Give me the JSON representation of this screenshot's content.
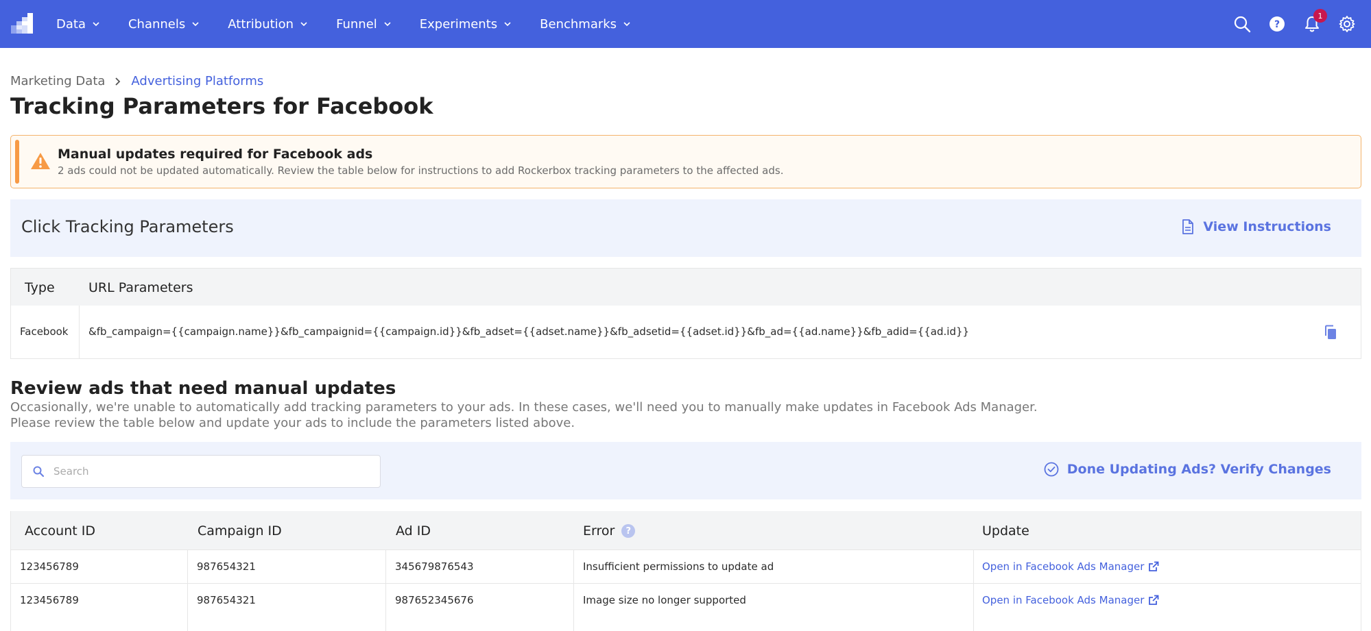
{
  "nav": {
    "items": [
      {
        "label": "Data"
      },
      {
        "label": "Channels"
      },
      {
        "label": "Attribution"
      },
      {
        "label": "Funnel"
      },
      {
        "label": "Experiments"
      },
      {
        "label": "Benchmarks"
      }
    ],
    "notification_count": "1"
  },
  "breadcrumb": {
    "root": "Marketing Data",
    "current": "Advertising Platforms"
  },
  "page_title": "Tracking Parameters for Facebook",
  "warning": {
    "title": "Manual updates required for Facebook ads",
    "text": "2 ads could not be updated automatically. Review the table below for instructions to add Rockerbox tracking parameters to the affected ads.",
    "color": "#f79a45"
  },
  "click_tracking": {
    "title": "Click Tracking Parameters",
    "view_instructions": "View Instructions"
  },
  "param_table": {
    "headers": [
      "Type",
      "URL Parameters"
    ],
    "rows": [
      {
        "type": "Facebook",
        "url": "&fb_campaign={{campaign.name}}&fb_campaignid={{campaign.id}}&fb_adset={{adset.name}}&fb_adsetid={{adset.id}}&fb_ad={{ad.name}}&fb_adid={{ad.id}}"
      }
    ]
  },
  "review": {
    "title": "Review ads that need manual updates",
    "desc_line1": "Occasionally, we're unable to automatically add tracking parameters to your ads. In these cases, we'll need you to manually make updates in Facebook Ads Manager.",
    "desc_line2": "Please review the table below and update your ads to include the parameters listed above.",
    "search_placeholder": "Search",
    "search_value": "",
    "verify_button": "Done Updating Ads? Verify Changes"
  },
  "ads_table": {
    "headers": [
      "Account ID",
      "Campaign ID",
      "Ad ID",
      "Error",
      "Update"
    ],
    "error_help": "?",
    "rows": [
      {
        "account_id": "123456789",
        "campaign_id": "987654321",
        "ad_id": "345679876543",
        "error": "Insufficient permissions to update ad",
        "update": "Open in Facebook Ads Manager"
      },
      {
        "account_id": "123456789",
        "campaign_id": "987654321",
        "ad_id": "987652345676",
        "error": "Image size no longer supported",
        "update": "Open in Facebook Ads Manager"
      }
    ]
  },
  "colors": {
    "nav_bg": "#4461DD",
    "accent": "#4461DD",
    "badge": "#c8174e",
    "panel_bg": "#eff3fd"
  }
}
